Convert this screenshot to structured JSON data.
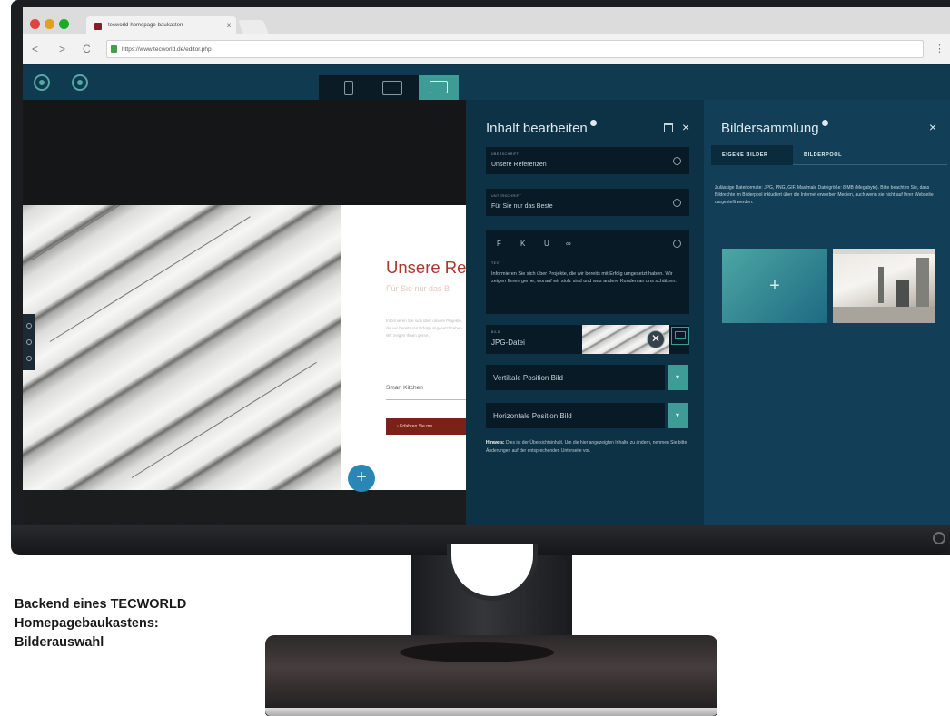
{
  "caption": {
    "line1": "Backend eines TECWORLD",
    "line2": "Homepagebaukastens:",
    "line3": "Bilderauswahl"
  },
  "browser": {
    "tab_title": "tecworld-homepage-baukasten",
    "tab_close": "x",
    "url": "https://www.tecworld.de/editor.php",
    "traffic_lights": [
      "#e0443e",
      "#dea123",
      "#1aab29"
    ]
  },
  "preview": {
    "heading": "Unsere Re",
    "subheading": "Für Sie nur das B",
    "paragraph": "Informieren Sie sich über unsere Projekte, die wir bereits mit Erfolg umgesetzt haben. Wir zeigen Ihnen gerne,",
    "link": "Smart Kitchen",
    "button": "Erfahren Sie me",
    "fab": "+"
  },
  "editor": {
    "title": "Inhalt bearbeiten",
    "fields": [
      {
        "label": "ÜBERSCHRIFT",
        "value": "Unsere Referenzen"
      },
      {
        "label": "UNTERSCHRIFT",
        "value": "Für Sie nur das Beste"
      }
    ],
    "text_field": {
      "label": "TEXT",
      "toolbar": [
        "F",
        "K",
        "U",
        "∞"
      ],
      "body": "Informieren Sie sich über Projekte, die wir bereits mit Erfolg umgesetzt haben. Wir zeigen Ihnen gerne, worauf wir stolz sind und was andere Kunden an uns schätzen."
    },
    "image_field": {
      "label": "BILD",
      "value": "JPG-Datei",
      "delete": "✕"
    },
    "selects": [
      {
        "value": "Vertikale Position Bild",
        "arrow": "▾"
      },
      {
        "value": "Horizontale Position Bild",
        "arrow": "▾"
      }
    ],
    "hint_label": "Hinweis:",
    "hint_text": "Dies ist der Übersichtsinhalt. Um die hier angezeigten Inhalte zu ändern, nehmen Sie bitte Änderungen auf der entsprechenden Unterseite vor."
  },
  "gallery": {
    "title": "Bildersammlung",
    "tabs": [
      "EIGENE BILDER",
      "BILDERPOOL"
    ],
    "info": "Zulässige Dateiformate: JPG, PNG, GIF. Maximale Dateigröße: 8 MB (Megabyte). Bitte beachten Sie, dass Bildrechte im Bilderpool inkludiert über die Internet erworben Medien, auch wenn sie nicht auf Ihrer Webseite dargestellt werden.",
    "upload_plus": "+",
    "close": "×"
  },
  "colors": {
    "accent": "#3e9c97",
    "panel": "#0d3145",
    "heading_red": "#a8392a"
  }
}
